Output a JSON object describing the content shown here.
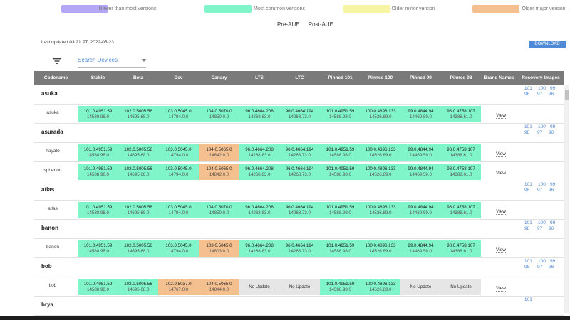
{
  "legend": [
    {
      "label": "Newer than most versions",
      "color": "#b4a7f5"
    },
    {
      "label": "Most common versions",
      "color": "#7ff5c9"
    },
    {
      "label": "Older minor version",
      "color": "#f7f5a3"
    },
    {
      "label": "Older major version",
      "color": "#f4c08f"
    }
  ],
  "toggles": [
    "Pre-AUE",
    "Post-AUE"
  ],
  "last_updated": "Last updated 03:21 PT, 2022-05-23",
  "download_label": "DOWNLOAD",
  "search_placeholder": "Search Devices",
  "headers": [
    "Codename",
    "Stable",
    "Beta",
    "Dev",
    "Canary",
    "LTS",
    "LTC",
    "Pinned 101",
    "Pinned 100",
    "Pinned 99",
    "Pinned 98",
    "Brand Names",
    "Recovery Images"
  ],
  "view_label": "View",
  "no_update_label": "No Update",
  "groups": [
    {
      "name": "asuka",
      "recovery": [
        "101",
        "100",
        "99",
        "98",
        "97",
        "96"
      ],
      "devices": [
        {
          "name": "asuka",
          "cells": [
            {
              "v": "101.0.4951.59",
              "b": "14588.98.0",
              "c": "g"
            },
            {
              "v": "102.0.5005.56",
              "b": "14695.68.0",
              "c": "g"
            },
            {
              "v": "103.0.5045.0",
              "b": "14794.0.0",
              "c": "g"
            },
            {
              "v": "104.0.5070.0",
              "b": "14850.0.0",
              "c": "g"
            },
            {
              "v": "96.0.4664.208",
              "b": "14268.83.0",
              "c": "g"
            },
            {
              "v": "96.0.4664.194",
              "b": "14268.73.0",
              "c": "g"
            },
            {
              "v": "101.0.4951.59",
              "b": "14588.98.0",
              "c": "g"
            },
            {
              "v": "100.0.4896.133",
              "b": "14526.89.0",
              "c": "g"
            },
            {
              "v": "99.0.4844.94",
              "b": "14469.59.0",
              "c": "g"
            },
            {
              "v": "98.0.4758.107",
              "b": "14388.61.0",
              "c": "g"
            }
          ]
        }
      ]
    },
    {
      "name": "asurada",
      "recovery": [
        "101",
        "100",
        "99",
        "98",
        "97",
        "96"
      ],
      "devices": [
        {
          "name": "hayato",
          "cells": [
            {
              "v": "101.0.4951.59",
              "b": "14588.98.0",
              "c": "g"
            },
            {
              "v": "102.0.5005.56",
              "b": "14695.68.0",
              "c": "g"
            },
            {
              "v": "103.0.5045.0",
              "b": "14794.0.0",
              "c": "g"
            },
            {
              "v": "104.0.5065.0",
              "b": "14842.0.0",
              "c": "o"
            },
            {
              "v": "96.0.4664.208",
              "b": "14268.83.0",
              "c": "g"
            },
            {
              "v": "96.0.4664.194",
              "b": "14268.73.0",
              "c": "g"
            },
            {
              "v": "101.0.4951.59",
              "b": "14588.98.0",
              "c": "g"
            },
            {
              "v": "100.0.4896.133",
              "b": "14526.89.0",
              "c": "g"
            },
            {
              "v": "99.0.4844.94",
              "b": "14469.59.0",
              "c": "g"
            },
            {
              "v": "98.0.4758.107",
              "b": "14388.61.0",
              "c": "g"
            }
          ]
        },
        {
          "name": "spherion",
          "cells": [
            {
              "v": "101.0.4951.59",
              "b": "14588.98.0",
              "c": "g"
            },
            {
              "v": "102.0.5005.56",
              "b": "14695.68.0",
              "c": "g"
            },
            {
              "v": "103.0.5045.0",
              "b": "14794.0.0",
              "c": "g"
            },
            {
              "v": "104.0.5065.0",
              "b": "14842.0.0",
              "c": "o"
            },
            {
              "v": "96.0.4664.208",
              "b": "14268.83.0",
              "c": "g"
            },
            {
              "v": "96.0.4664.194",
              "b": "14268.73.0",
              "c": "g"
            },
            {
              "v": "101.0.4951.59",
              "b": "14588.98.0",
              "c": "g"
            },
            {
              "v": "100.0.4896.133",
              "b": "14526.89.0",
              "c": "g"
            },
            {
              "v": "99.0.4844.94",
              "b": "14469.59.0",
              "c": "g"
            },
            {
              "v": "98.0.4758.107",
              "b": "14388.61.0",
              "c": "g"
            }
          ]
        }
      ]
    },
    {
      "name": "atlas",
      "recovery": [
        "101",
        "100",
        "99",
        "98",
        "97",
        "96"
      ],
      "devices": [
        {
          "name": "atlas",
          "cells": [
            {
              "v": "101.0.4951.59",
              "b": "14588.98.0",
              "c": "g"
            },
            {
              "v": "102.0.5005.56",
              "b": "14695.68.0",
              "c": "g"
            },
            {
              "v": "103.0.5045.0",
              "b": "14794.0.0",
              "c": "g"
            },
            {
              "v": "104.0.5070.0",
              "b": "14850.0.0",
              "c": "g"
            },
            {
              "v": "96.0.4664.208",
              "b": "14268.83.0",
              "c": "g"
            },
            {
              "v": "96.0.4664.194",
              "b": "14268.73.0",
              "c": "g"
            },
            {
              "v": "101.0.4951.59",
              "b": "14588.98.0",
              "c": "g"
            },
            {
              "v": "100.0.4896.133",
              "b": "14526.89.0",
              "c": "g"
            },
            {
              "v": "99.0.4844.94",
              "b": "14469.59.0",
              "c": "g"
            },
            {
              "v": "98.0.4758.107",
              "b": "14388.61.0",
              "c": "g"
            }
          ]
        }
      ]
    },
    {
      "name": "banon",
      "recovery": [
        "101",
        "100",
        "99",
        "98",
        "97",
        "96"
      ],
      "devices": [
        {
          "name": "banon",
          "cells": [
            {
              "v": "101.0.4951.59",
              "b": "14588.98.0",
              "c": "g"
            },
            {
              "v": "102.0.5005.56",
              "b": "14695.68.0",
              "c": "g"
            },
            {
              "v": "103.0.5045.0",
              "b": "14794.0.0",
              "c": "g"
            },
            {
              "v": "103.0.5045.0",
              "b": "14803.0.0",
              "c": "o"
            },
            {
              "v": "96.0.4664.208",
              "b": "14268.83.0",
              "c": "g"
            },
            {
              "v": "96.0.4664.194",
              "b": "14268.73.0",
              "c": "g"
            },
            {
              "v": "101.0.4951.59",
              "b": "14588.98.0",
              "c": "g"
            },
            {
              "v": "100.0.4896.133",
              "b": "14526.89.0",
              "c": "g"
            },
            {
              "v": "99.0.4844.94",
              "b": "14469.59.0",
              "c": "g"
            },
            {
              "v": "98.0.4758.107",
              "b": "14388.61.0",
              "c": "g"
            }
          ]
        }
      ]
    },
    {
      "name": "bob",
      "recovery": [
        "101",
        "100",
        "99",
        "98",
        "97",
        "96"
      ],
      "devices": [
        {
          "name": "bob",
          "cells": [
            {
              "v": "101.0.4951.59",
              "b": "14588.98.0",
              "c": "g"
            },
            {
              "v": "102.0.5005.56",
              "b": "14695.68.0",
              "c": "g"
            },
            {
              "v": "102.0.5037.0",
              "b": "14767.0.0",
              "c": "o"
            },
            {
              "v": "104.0.5065.0",
              "b": "14844.0.0",
              "c": "o"
            },
            {
              "nu": true
            },
            {
              "nu": true
            },
            {
              "v": "101.0.4951.59",
              "b": "14588.98.0",
              "c": "g"
            },
            {
              "v": "100.0.4896.133",
              "b": "14526.89.0",
              "c": "g"
            },
            {
              "nu": true
            },
            {
              "nu": true
            }
          ]
        }
      ]
    },
    {
      "name": "brya",
      "recovery": [
        "101"
      ],
      "devices": []
    }
  ],
  "colors": {
    "green": "#7ff5c9",
    "orange": "#f4c08f",
    "gray": "#e6e6e6",
    "header": "#7a7a7a",
    "accent": "#4f8ad6"
  }
}
